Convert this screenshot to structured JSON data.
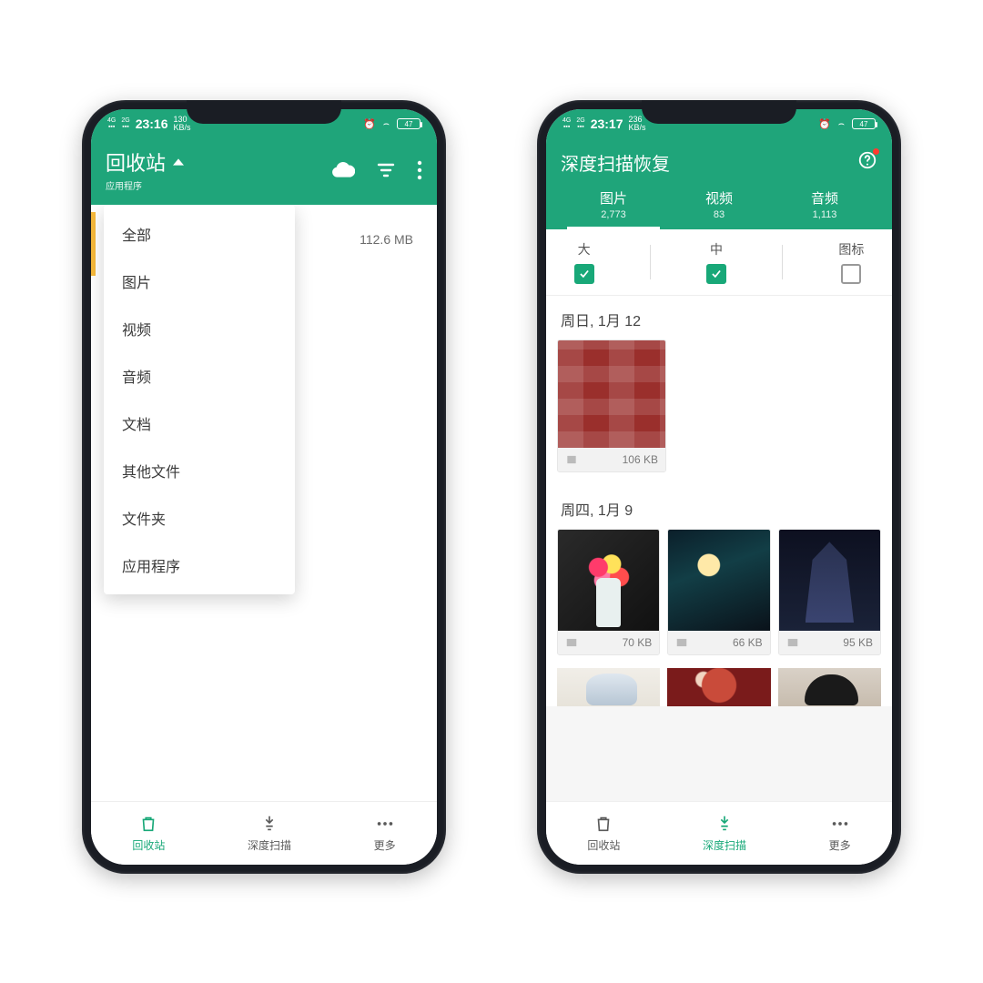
{
  "colors": {
    "accent": "#1fa57a",
    "active": "#18a878"
  },
  "left": {
    "status": {
      "time": "23:16",
      "speed": "130",
      "speed_unit": "KB/s",
      "battery": "47"
    },
    "appbar": {
      "title": "回收站",
      "subtitle": "应用程序"
    },
    "size_readout": "112.6 MB",
    "dropdown": [
      "全部",
      "图片",
      "视频",
      "音频",
      "文档",
      "其他文件",
      "文件夹",
      "应用程序"
    ],
    "nav": {
      "a": "回收站",
      "b": "深度扫描",
      "c": "更多"
    }
  },
  "right": {
    "status": {
      "time": "23:17",
      "speed": "236",
      "speed_unit": "KB/s",
      "battery": "47"
    },
    "appbar": {
      "title": "深度扫描恢复"
    },
    "tabs": [
      {
        "label": "图片",
        "count": "2,773"
      },
      {
        "label": "视频",
        "count": "83"
      },
      {
        "label": "音频",
        "count": "1,113"
      }
    ],
    "filters": [
      {
        "label": "大",
        "checked": true
      },
      {
        "label": "中",
        "checked": true
      },
      {
        "label": "图标",
        "checked": false
      }
    ],
    "section1": {
      "title": "周日, 1月 12",
      "items": [
        {
          "size": "106 KB"
        }
      ]
    },
    "section2": {
      "title": "周四, 1月 9",
      "items": [
        {
          "size": "70 KB"
        },
        {
          "size": "66 KB"
        },
        {
          "size": "95 KB"
        }
      ]
    },
    "nav": {
      "a": "回收站",
      "b": "深度扫描",
      "c": "更多"
    }
  }
}
